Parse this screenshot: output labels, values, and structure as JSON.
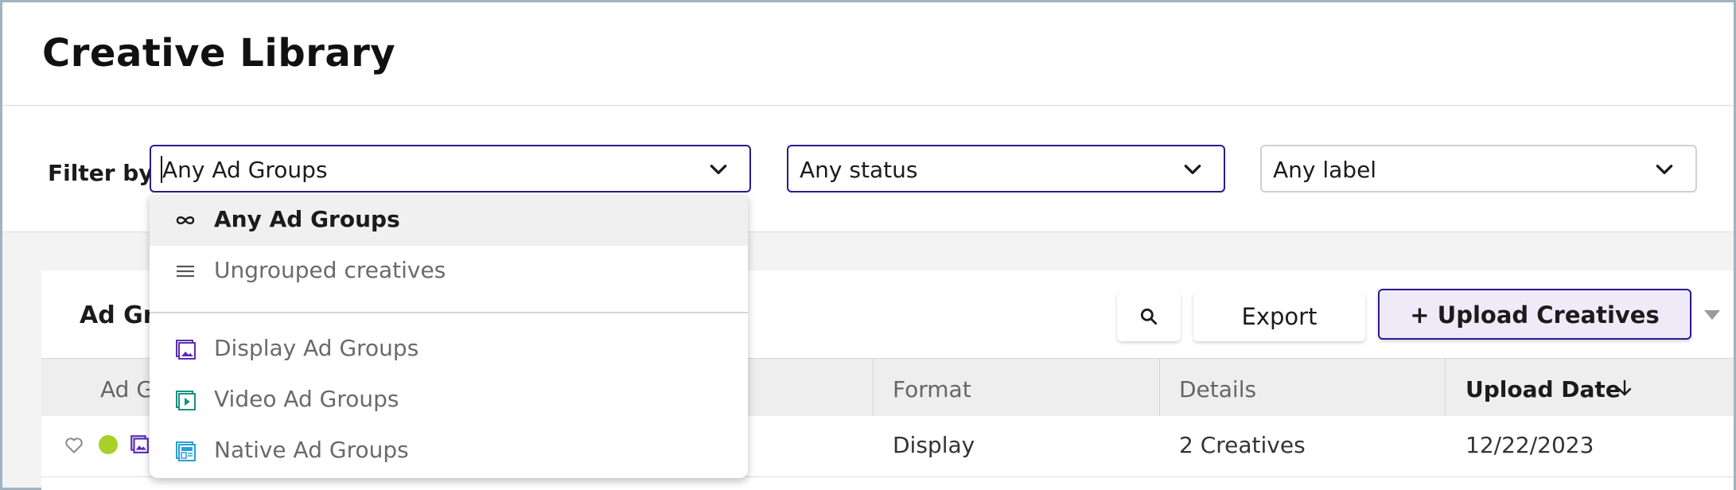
{
  "page": {
    "title": "Creative Library"
  },
  "filters": {
    "label": "Filter by:",
    "ad_groups": {
      "value": "Any Ad Groups"
    },
    "status": {
      "value": "Any status"
    },
    "labels": {
      "value": "Any label"
    }
  },
  "dropdown": {
    "items": [
      {
        "label": "Any Ad Groups",
        "icon": "infinity-icon",
        "selected": true
      },
      {
        "label": "Ungrouped creatives",
        "icon": "list-icon"
      },
      {
        "label": "Display Ad Groups",
        "icon": "image-icon",
        "color": "#5b2bb5"
      },
      {
        "label": "Video Ad Groups",
        "icon": "video-icon",
        "color": "#1a8f86"
      },
      {
        "label": "Native Ad Groups",
        "icon": "native-icon",
        "color": "#2a9fd6"
      }
    ]
  },
  "card": {
    "title": "Ad Gr",
    "search_icon": "search-icon",
    "export_label": "Export",
    "upload_label": "+ Upload Creatives"
  },
  "table": {
    "columns": {
      "ad_group": "Ad G",
      "format": "Format",
      "details": "Details",
      "upload_date": "Upload Date"
    },
    "rows": [
      {
        "format": "Display",
        "details": "2 Creatives",
        "upload_date": "12/22/2023",
        "status_color": "#a7d128"
      }
    ]
  },
  "colors": {
    "accent": "#2b1b8f",
    "upload_bg": "#efeaf7",
    "status_active": "#a7d128"
  }
}
